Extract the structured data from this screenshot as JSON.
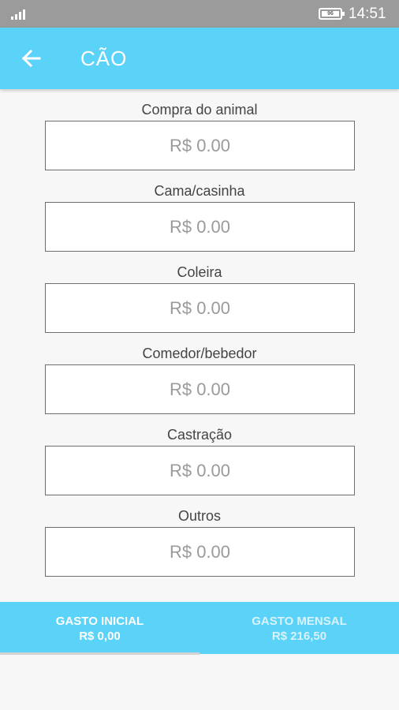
{
  "status_bar": {
    "battery": "96",
    "time": "14:51"
  },
  "app_bar": {
    "title": "CÃO",
    "back_icon": "arrow-left-icon"
  },
  "fields": [
    {
      "label": "Compra do animal",
      "placeholder": "R$ 0.00"
    },
    {
      "label": "Cama/casinha",
      "placeholder": "R$ 0.00"
    },
    {
      "label": "Coleira",
      "placeholder": "R$ 0.00"
    },
    {
      "label": "Comedor/bebedor",
      "placeholder": "R$ 0.00"
    },
    {
      "label": "Castração",
      "placeholder": "R$ 0.00"
    },
    {
      "label": "Outros",
      "placeholder": "R$ 0.00"
    }
  ],
  "tabs": [
    {
      "title": "GASTO INICIAL",
      "value": "R$ 0,00",
      "selected": true
    },
    {
      "title": "GASTO MENSAL",
      "value": "R$ 216,50",
      "selected": false
    }
  ],
  "colors": {
    "accent": "#5bd2f8",
    "status_bar": "#9b9b9b",
    "background": "#f7f7f7"
  }
}
